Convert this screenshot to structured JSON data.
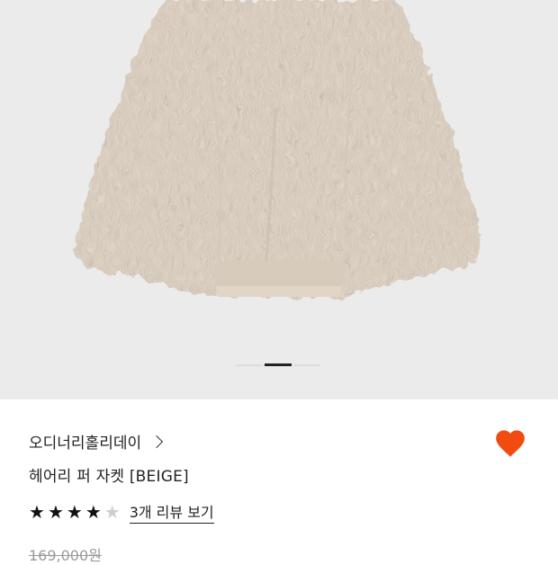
{
  "product": {
    "brand": "오디너리홀리데이",
    "title": "헤어리 퍼 자켓 [BEIGE]",
    "rating": 4,
    "rating_max": 5,
    "review_link": "3개 리뷰 보기",
    "original_price": "169,000원",
    "favorited": true
  },
  "gallery": {
    "current_index": 1,
    "count": 3,
    "image_subject": "beige shaggy faux fur jacket"
  },
  "colors": {
    "heart": "#f24b12",
    "gallery_bg": "#ebebeb",
    "fur": "#e4d8c8"
  },
  "icons": [
    "chevron-right-icon",
    "heart-icon",
    "star-icon"
  ]
}
